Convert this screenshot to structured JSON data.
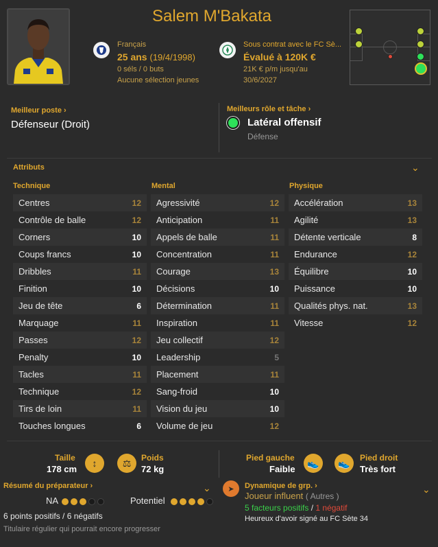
{
  "player": {
    "name": "Salem M'Bakata",
    "nationality": "Français",
    "age": "25 ans",
    "dob": "(19/4/1998)",
    "caps": "0 séls / 0 buts",
    "youth": "Aucune sélection jeunes",
    "contract": "Sous contrat avec le FC Sè...",
    "value": "Évalué à 120K €",
    "wage": "21K € p/m jusqu'au",
    "contract_end": "30/6/2027"
  },
  "best_position": {
    "label": "Meilleur poste",
    "value": "Défenseur (Droit)"
  },
  "best_role": {
    "label": "Meilleurs rôle et tâche",
    "role": "Latéral offensif",
    "duty": "Défense"
  },
  "attributes": {
    "title": "Attributs",
    "technique": {
      "header": "Technique",
      "rows": [
        {
          "name": "Centres",
          "value": "12"
        },
        {
          "name": "Contrôle de balle",
          "value": "12"
        },
        {
          "name": "Corners",
          "value": "10"
        },
        {
          "name": "Coups francs",
          "value": "10"
        },
        {
          "name": "Dribbles",
          "value": "11"
        },
        {
          "name": "Finition",
          "value": "10"
        },
        {
          "name": "Jeu de tête",
          "value": "6"
        },
        {
          "name": "Marquage",
          "value": "11"
        },
        {
          "name": "Passes",
          "value": "12"
        },
        {
          "name": "Penalty",
          "value": "10"
        },
        {
          "name": "Tacles",
          "value": "11"
        },
        {
          "name": "Technique",
          "value": "12"
        },
        {
          "name": "Tirs de loin",
          "value": "11"
        },
        {
          "name": "Touches longues",
          "value": "6"
        }
      ]
    },
    "mental": {
      "header": "Mental",
      "rows": [
        {
          "name": "Agressivité",
          "value": "12"
        },
        {
          "name": "Anticipation",
          "value": "11"
        },
        {
          "name": "Appels de balle",
          "value": "11"
        },
        {
          "name": "Concentration",
          "value": "11"
        },
        {
          "name": "Courage",
          "value": "13"
        },
        {
          "name": "Décisions",
          "value": "10"
        },
        {
          "name": "Détermination",
          "value": "11"
        },
        {
          "name": "Inspiration",
          "value": "11"
        },
        {
          "name": "Jeu collectif",
          "value": "12"
        },
        {
          "name": "Leadership",
          "value": "5"
        },
        {
          "name": "Placement",
          "value": "11"
        },
        {
          "name": "Sang-froid",
          "value": "10"
        },
        {
          "name": "Vision du jeu",
          "value": "10"
        },
        {
          "name": "Volume de jeu",
          "value": "12"
        }
      ]
    },
    "physique": {
      "header": "Physique",
      "rows": [
        {
          "name": "Accélération",
          "value": "13"
        },
        {
          "name": "Agilité",
          "value": "13"
        },
        {
          "name": "Détente verticale",
          "value": "8"
        },
        {
          "name": "Endurance",
          "value": "12"
        },
        {
          "name": "Équilibre",
          "value": "10"
        },
        {
          "name": "Puissance",
          "value": "10"
        },
        {
          "name": "Qualités phys. nat.",
          "value": "13"
        },
        {
          "name": "Vitesse",
          "value": "12"
        }
      ]
    }
  },
  "physical": {
    "height_label": "Taille",
    "height": "178 cm",
    "weight_label": "Poids",
    "weight": "72 kg",
    "left_foot_label": "Pied gauche",
    "left_foot": "Faible",
    "right_foot_label": "Pied droit",
    "right_foot": "Très fort"
  },
  "coach_report": {
    "label": "Résumé du préparateur",
    "na_label": "NA",
    "na_stars": 3,
    "potential_label": "Potentiel",
    "potential_stars": 4,
    "max_stars": 5,
    "points": "6 points positifs / 6 négatifs",
    "summary": "Titulaire régulier qui pourrait encore progresser"
  },
  "group_dynamics": {
    "label": "Dynamique de grp.",
    "status": "Joueur influent",
    "group": "( Autres )",
    "positives": "5 facteurs positifs",
    "separator": "/",
    "negatives": "1 négatif",
    "happiness": "Heureux d'avoir signé au FC Sète 34"
  },
  "colors": {
    "accent": "#e0a72e",
    "positive": "#3ad04a",
    "negative": "#e04a3a",
    "role_dot": "#2ee05a"
  }
}
